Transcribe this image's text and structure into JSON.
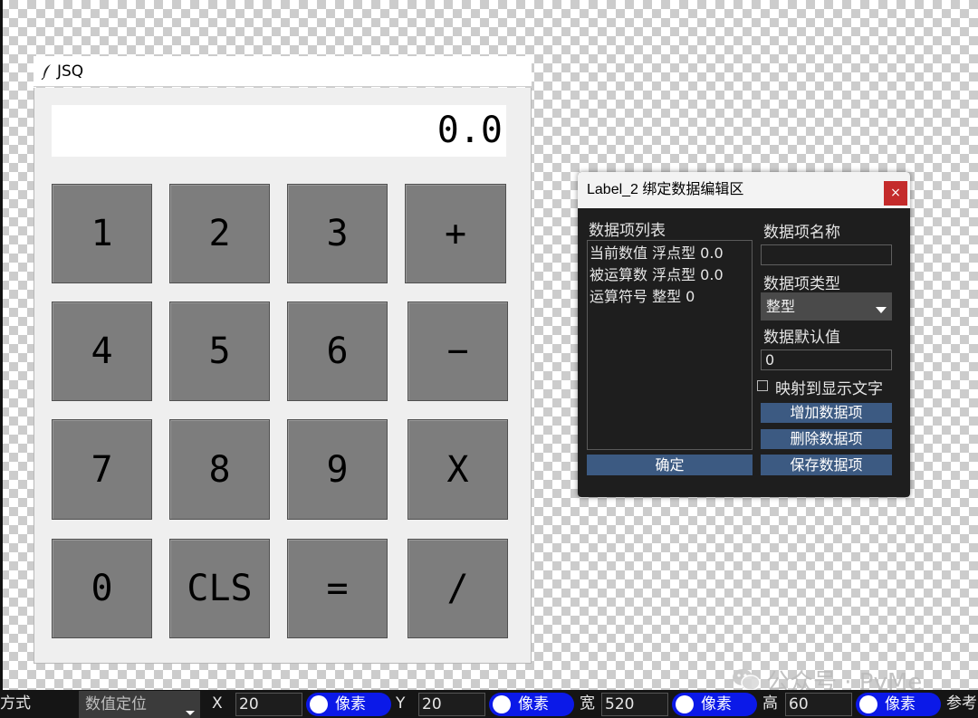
{
  "calculator": {
    "title": "JSQ",
    "display": "0.0",
    "keys": [
      "1",
      "2",
      "3",
      "+",
      "4",
      "5",
      "6",
      "−",
      "7",
      "8",
      "9",
      "X",
      "0",
      "CLS",
      "=",
      "/"
    ]
  },
  "dialog": {
    "title": "Label_2 绑定数据编辑区",
    "close": "×",
    "list_title": "数据项列表",
    "items": [
      "当前数值 浮点型 0.0",
      "被运算数 浮点型 0.0",
      "运算符号 整型 0"
    ],
    "name_label": "数据项名称",
    "name_value": "",
    "type_label": "数据项类型",
    "type_value": "整型",
    "default_label": "数据默认值",
    "default_value": "0",
    "map_checkbox_label": "映射到显示文字",
    "map_checked": false,
    "add_button": "增加数据项",
    "delete_button": "删除数据项",
    "save_button": "保存数据项",
    "ok_button": "确定"
  },
  "toolbar": {
    "mode_label": "方式",
    "positioning": "数值定位",
    "x_label": "X",
    "x_value": "20",
    "x_unit": "像素",
    "y_label": "Y",
    "y_value": "20",
    "y_unit": "像素",
    "w_label": "宽",
    "w_value": "520",
    "w_unit": "像素",
    "h_label": "高",
    "h_value": "60",
    "h_unit": "像素",
    "ref_label": "参考"
  },
  "watermark": "公众号 · PyMe",
  "colors": {
    "key_bg": "#7d7d7d",
    "dialog_bg": "#1e1e1e",
    "button_bg": "#3c5a82",
    "unit_toggle": "#0b19e8",
    "close_bg": "#c42b2b"
  }
}
